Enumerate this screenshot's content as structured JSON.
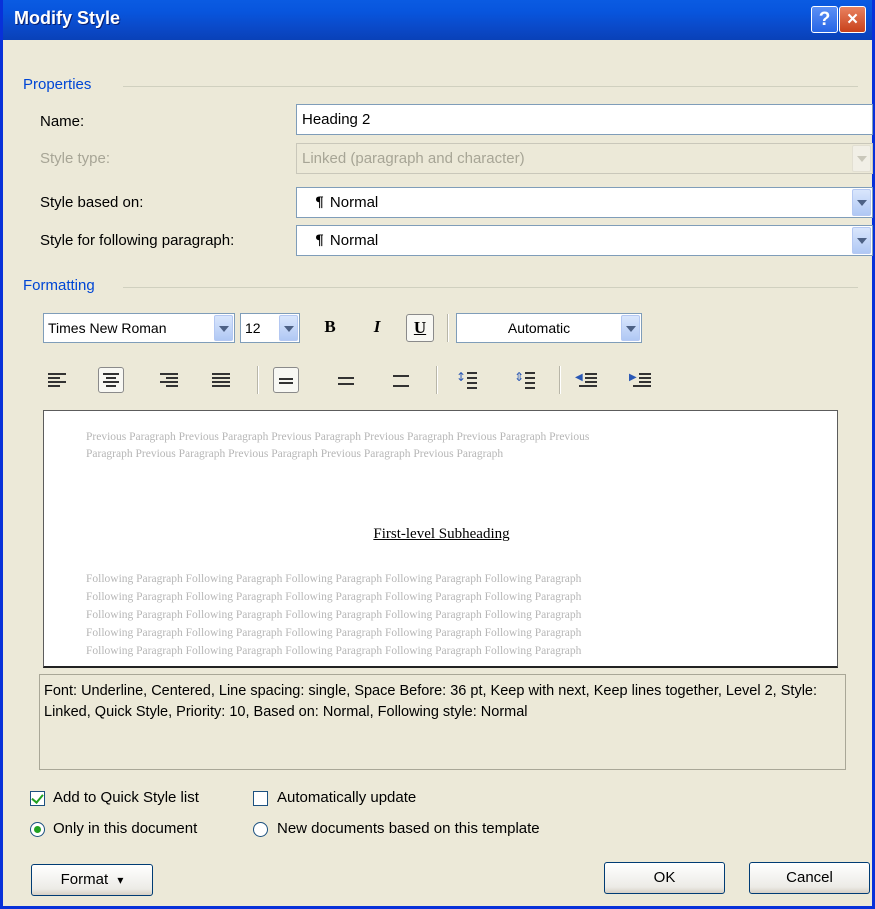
{
  "window": {
    "title": "Modify Style",
    "help_icon": "?",
    "close_icon": "×"
  },
  "properties": {
    "section_label": "Properties",
    "name_label": "Name:",
    "name_value": "Heading 2",
    "style_type_label": "Style type:",
    "style_type_value": "Linked (paragraph and character)",
    "based_on_label": "Style based on:",
    "based_on_value": "Normal",
    "following_label": "Style for following paragraph:",
    "following_value": "Normal",
    "pilcrow": "¶"
  },
  "formatting": {
    "section_label": "Formatting",
    "font_name": "Times New Roman",
    "font_size": "12",
    "bold": "B",
    "italic": "I",
    "underline": "U",
    "underline_pressed": true,
    "color": "Automatic",
    "alignment_selected": "center",
    "line_spacing_selected": "single"
  },
  "preview": {
    "previous_line1": "Previous Paragraph Previous Paragraph Previous Paragraph Previous Paragraph Previous Paragraph Previous",
    "previous_line2": "Paragraph Previous Paragraph Previous Paragraph Previous Paragraph Previous Paragraph",
    "sample_text": "First-level Subheading",
    "following_line": "Following Paragraph Following Paragraph Following Paragraph Following Paragraph Following Paragraph"
  },
  "description": "Font: Underline, Centered, Line spacing:  single, Space Before:  36 pt, Keep with next, Keep lines together, Level 2, Style: Linked, Quick Style, Priority: 10, Based on: Normal, Following style: Normal",
  "options": {
    "add_quick_style_label": "Add to Quick Style list",
    "add_quick_style_checked": true,
    "auto_update_label": "Automatically update",
    "auto_update_checked": false,
    "only_this_doc_label": "Only in this document",
    "new_docs_label": "New documents based on this template",
    "scope_selected": "only_this_document"
  },
  "buttons": {
    "format": "Format",
    "format_arrow": "▾",
    "ok": "OK",
    "cancel": "Cancel"
  },
  "colors": {
    "title_bar": "#0a5be2",
    "section_label": "#0046d5",
    "dialog_bg": "#ece9d8"
  }
}
